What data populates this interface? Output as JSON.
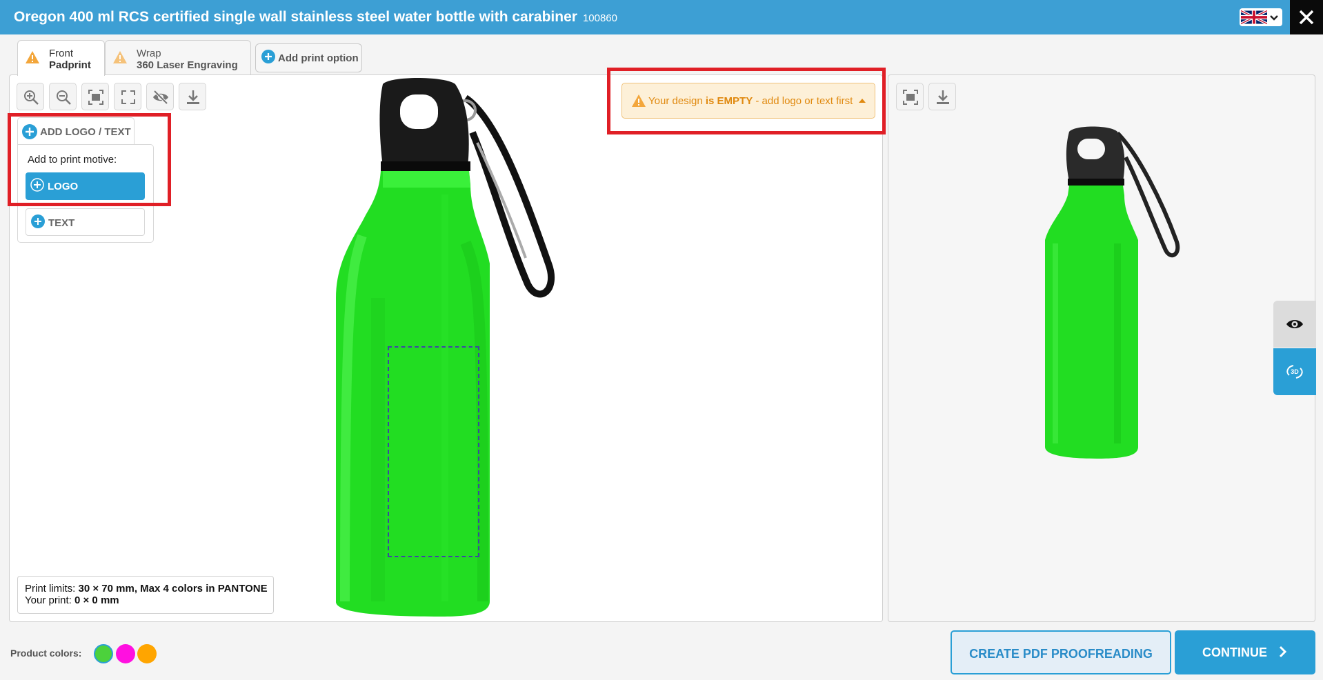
{
  "header": {
    "title": "Oregon 400 ml RCS certified single wall stainless steel water bottle with carabiner",
    "product_code": "100860",
    "language_icon": "uk-flag-icon",
    "close_icon": "close-icon"
  },
  "tabs": [
    {
      "label": "Front",
      "sublabel": "Padprint",
      "icon": "warning-icon",
      "active": true
    },
    {
      "label": "Wrap",
      "sublabel": "360 Laser Engraving",
      "icon": "warning-icon",
      "active": false
    }
  ],
  "add_print_option": "Add print option",
  "toolbar": [
    "zoom-in-icon",
    "zoom-out-icon",
    "fit-screen-icon",
    "fullscreen-icon",
    "hide-icon",
    "download-icon"
  ],
  "add_menu": {
    "button_label": "ADD LOGO / TEXT",
    "motive_label": "Add to print motive:",
    "logo_label": "LOGO",
    "text_label": "TEXT"
  },
  "warning": {
    "prefix": "Your design",
    "emphasis": "is EMPTY",
    "suffix": "- add logo or text first"
  },
  "print_limits": {
    "label": "Print limits:",
    "value": "30 × 70 mm, Max 4 colors in PANTONE",
    "your_print_label": "Your print:",
    "your_print_value": "0 × 0 mm"
  },
  "preview": {
    "toolbar": [
      "fit-screen-icon",
      "download-icon"
    ],
    "side_buttons": [
      "eye-icon",
      "3d-rotate-icon"
    ],
    "three_d_label": "3D"
  },
  "product_colors": {
    "label": "Product colors:",
    "swatches": [
      "#4cd13c",
      "#ff10e0",
      "#ffa500"
    ],
    "selected": "#4cd13c"
  },
  "colors": {
    "header": "#3d9fd4",
    "accent": "#2a9fd6",
    "warning": "#e0890f",
    "highlight": "#e01f26",
    "bottle": "#22dd22"
  },
  "footer": {
    "pdf_label": "CREATE PDF PROOFREADING",
    "continue_label": "CONTINUE"
  }
}
